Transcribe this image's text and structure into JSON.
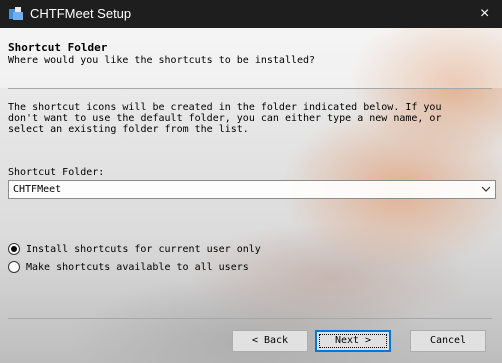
{
  "window": {
    "title": "CHTFMeet Setup",
    "close_label": "×"
  },
  "header": {
    "title": "Shortcut Folder",
    "subtitle": "Where would you like the shortcuts to be installed?"
  },
  "description": {
    "lines": [
      "The shortcut icons will be created in the folder indicated below. If you",
      "don't want to use the default folder, you can either type a new name, or",
      "select an existing folder from the list."
    ]
  },
  "shortcut_folder": {
    "label": "Shortcut Folder:",
    "value": "CHTFMeet"
  },
  "options": [
    {
      "label": "Install shortcuts for current user only",
      "selected": true
    },
    {
      "label": "Make shortcuts available to all users",
      "selected": false
    }
  ],
  "buttons": {
    "back": "< Back",
    "next": "Next >",
    "cancel": "Cancel"
  },
  "colors": {
    "titlebar": "#1e1e1e",
    "button_face": "#e1e1e1",
    "default_button_border": "#0078d7"
  }
}
